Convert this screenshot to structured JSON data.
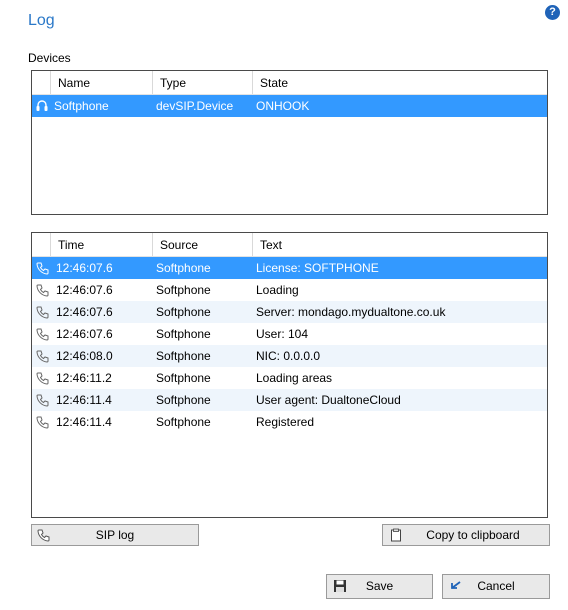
{
  "window": {
    "title": "Log",
    "help_label": "?"
  },
  "devices": {
    "section_label": "Devices",
    "columns": [
      "Name",
      "Type",
      "State"
    ],
    "rows": [
      {
        "name": "Softphone",
        "type": "devSIP.Device",
        "state": "ONHOOK",
        "icon": "headset-icon",
        "selected": true
      }
    ]
  },
  "log": {
    "columns": [
      "Time",
      "Source",
      "Text"
    ],
    "rows": [
      {
        "time": "12:46:07.6",
        "source": "Softphone",
        "text": "License: SOFTPHONE"
      },
      {
        "time": "12:46:07.6",
        "source": "Softphone",
        "text": "Loading"
      },
      {
        "time": "12:46:07.6",
        "source": "Softphone",
        "text": "Server: mondago.mydualtone.co.uk"
      },
      {
        "time": "12:46:07.6",
        "source": "Softphone",
        "text": "User: 104"
      },
      {
        "time": "12:46:08.0",
        "source": "Softphone",
        "text": "NIC: 0.0.0.0"
      },
      {
        "time": "12:46:11.2",
        "source": "Softphone",
        "text": "Loading areas"
      },
      {
        "time": "12:46:11.4",
        "source": "Softphone",
        "text": "User agent: DualtoneCloud"
      },
      {
        "time": "12:46:11.4",
        "source": "Softphone",
        "text": "Registered"
      }
    ]
  },
  "buttons": {
    "sip_log": "SIP log",
    "copy": "Copy to clipboard",
    "save": "Save",
    "cancel": "Cancel"
  },
  "colors": {
    "selection": "#3399ff",
    "title": "#2a78c8",
    "alt_row": "#eef5fc"
  }
}
